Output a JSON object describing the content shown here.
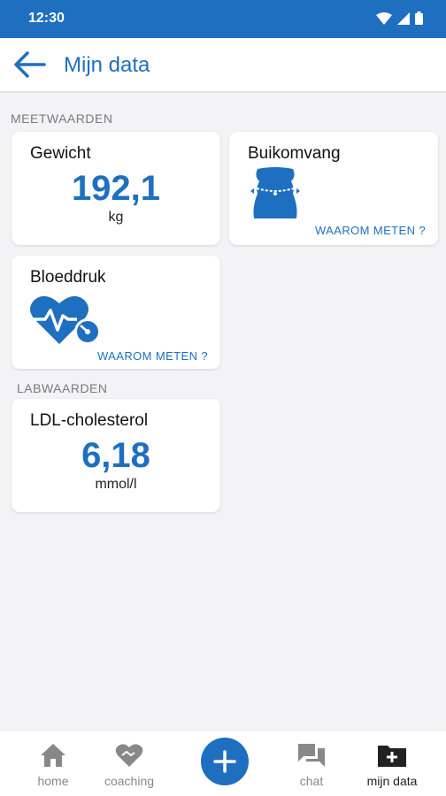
{
  "status": {
    "time": "12:30"
  },
  "header": {
    "title": "Mijn data"
  },
  "sections": {
    "meetwaarden": "MEETWAARDEN",
    "labwaarden": "LABWAARDEN"
  },
  "cards": {
    "gewicht": {
      "title": "Gewicht",
      "value": "192,1",
      "unit": "kg"
    },
    "buikomvang": {
      "title": "Buikomvang",
      "link": "WAAROM METEN ?"
    },
    "bloeddruk": {
      "title": "Bloeddruk",
      "link": "WAAROM METEN ?"
    },
    "ldl": {
      "title": "LDL-cholesterol",
      "value": "6,18",
      "unit": "mmol/l"
    }
  },
  "nav": {
    "home": "home",
    "coaching": "coaching",
    "chat": "chat",
    "mijn_data": "mijn data"
  },
  "colors": {
    "primary": "#1f6fc0",
    "inactive": "#888888",
    "background": "#f3f3f6"
  },
  "icons": [
    "back-arrow-icon",
    "wifi-icon",
    "signal-icon",
    "battery-icon",
    "waist-icon",
    "heart-pulse-icon",
    "home-icon",
    "heart-handshake-icon",
    "plus-icon",
    "chat-icon",
    "folder-plus-icon"
  ]
}
